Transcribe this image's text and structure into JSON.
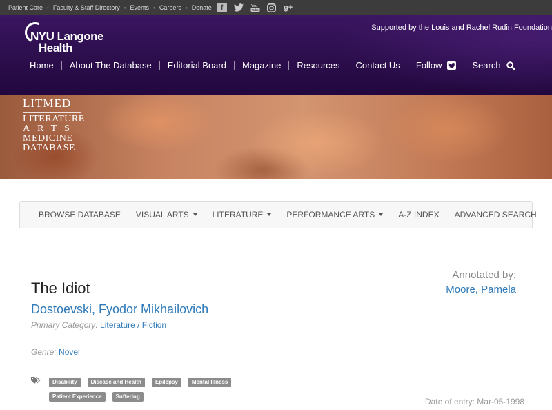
{
  "utility_bar": {
    "links": [
      "Patient Care",
      "Faculty & Staff Directory",
      "Events",
      "Careers",
      "Donate"
    ],
    "social_icons": [
      "facebook-icon",
      "twitter-icon",
      "youtube-icon",
      "instagram-icon",
      "google-plus-icon"
    ]
  },
  "header": {
    "logo_line1": "NYU Langone",
    "logo_line2": "Health",
    "supported_by": "Supported by the Louis and Rachel Rudin Foundation",
    "nav": [
      "Home",
      "About The Database",
      "Editorial Board",
      "Magazine",
      "Resources",
      "Contact Us",
      "Follow",
      "Search"
    ]
  },
  "banner": {
    "line1": "LITMED",
    "line2": "LITERATURE",
    "line3": "ARTS",
    "line4": "MEDICINE",
    "line5": "DATABASE"
  },
  "subnav": {
    "items": [
      "BROWSE DATABASE",
      "VISUAL ARTS",
      "LITERATURE",
      "PERFORMANCE ARTS",
      "A-Z INDEX",
      "ADVANCED SEARCH"
    ]
  },
  "entry": {
    "title": "The Idiot",
    "author": "Dostoevski, Fyodor Mikhailovich",
    "primary_category_label": "Primary Category:",
    "primary_category": "Literature",
    "category_sep": " / ",
    "sub_category": "Fiction",
    "genre_label": "Genre:",
    "genre": "Novel",
    "annotated_by_label": "Annotated by:",
    "annotator": "Moore, Pamela",
    "tags_row1": [
      "Disability",
      "Disease and Health",
      "Epilepsy",
      "Mental Illness"
    ],
    "tags_row2": [
      "Patient Experience",
      "Suffering"
    ],
    "date_of_entry": "Date of entry: Mar-05-1998"
  }
}
